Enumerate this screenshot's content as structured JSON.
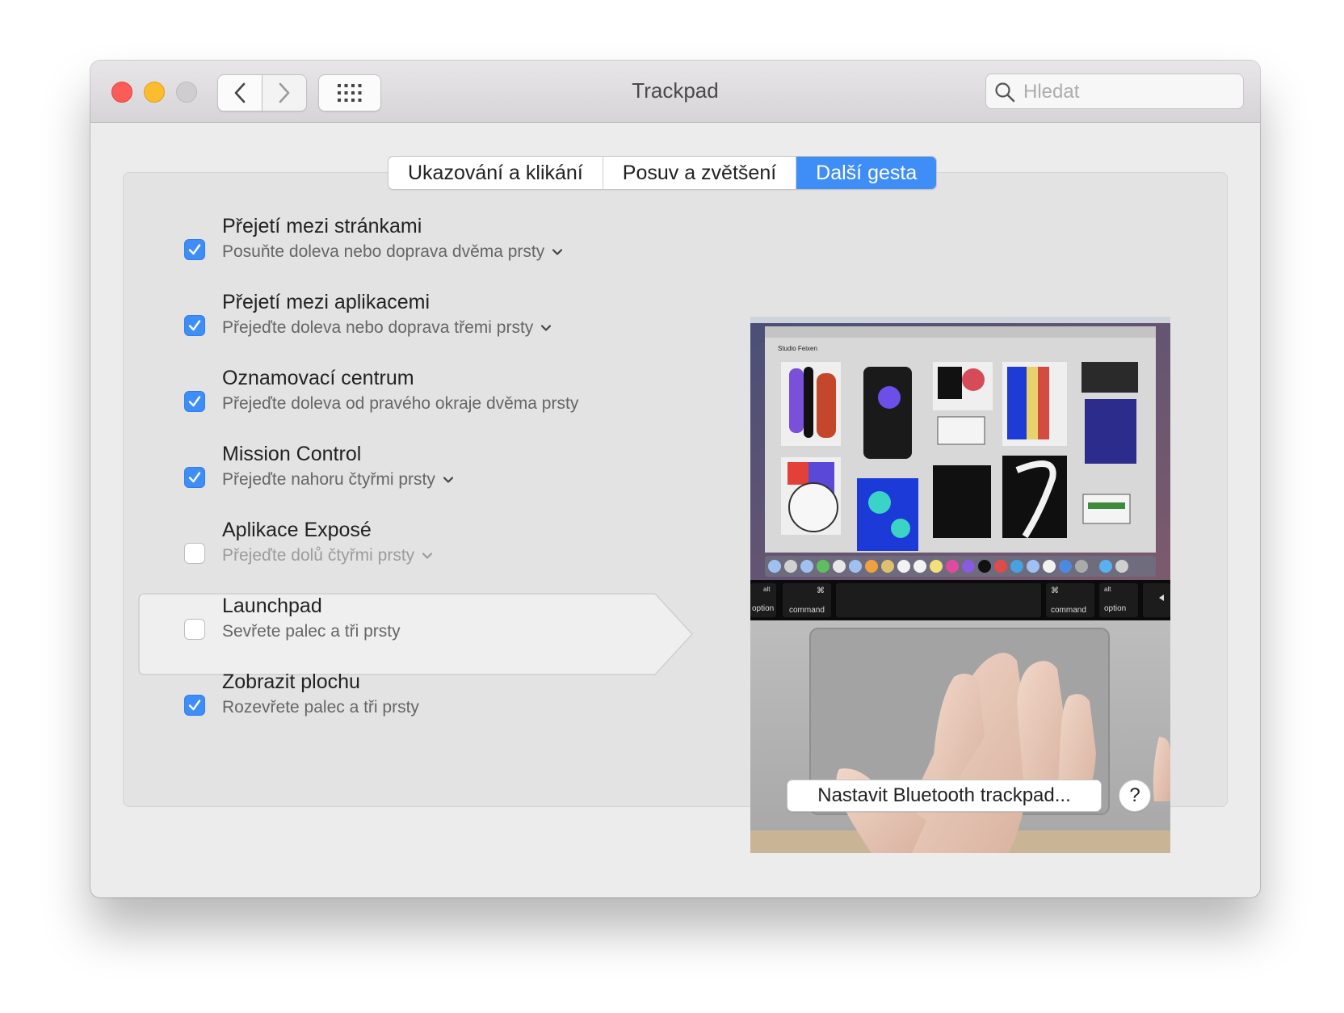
{
  "window": {
    "title": "Trackpad"
  },
  "search": {
    "placeholder": "Hledat"
  },
  "tabs": [
    {
      "label": "Ukazování a klikání",
      "active": false
    },
    {
      "label": "Posuv a zvětšení",
      "active": false
    },
    {
      "label": "Další gesta",
      "active": true
    }
  ],
  "gestures": [
    {
      "title": "Přejetí mezi stránkami",
      "description": "Posuňte doleva nebo doprava dvěma prsty",
      "checked": true,
      "has_dropdown": true
    },
    {
      "title": "Přejetí mezi aplikacemi",
      "description": "Přejeďte doleva nebo doprava třemi prsty",
      "checked": true,
      "has_dropdown": true
    },
    {
      "title": "Oznamovací centrum",
      "description": "Přejeďte doleva od pravého okraje dvěma prsty",
      "checked": true,
      "has_dropdown": false
    },
    {
      "title": "Mission Control",
      "description": "Přejeďte nahoru čtyřmi prsty",
      "checked": true,
      "has_dropdown": true
    },
    {
      "title": "Aplikace Exposé",
      "description": "Přejeďte dolů čtyřmi prsty",
      "checked": false,
      "has_dropdown": true
    },
    {
      "title": "Launchpad",
      "description": "Sevřete palec a tři prsty",
      "checked": false,
      "has_dropdown": false,
      "selected": true
    },
    {
      "title": "Zobrazit plochu",
      "description": "Rozevřete palec a tři prsty",
      "checked": true,
      "has_dropdown": false
    }
  ],
  "preview": {
    "app_title": "Studio Feixen",
    "keys": {
      "alt": "alt",
      "cmd_symbol": "⌘",
      "command": "command",
      "option": "option"
    }
  },
  "footer": {
    "bluetooth_button": "Nastavit Bluetooth trackpad...",
    "help_button": "?"
  },
  "colors": {
    "accent": "#3f8ef7",
    "close": "#fc5b57",
    "minimize": "#fdbc2e"
  }
}
